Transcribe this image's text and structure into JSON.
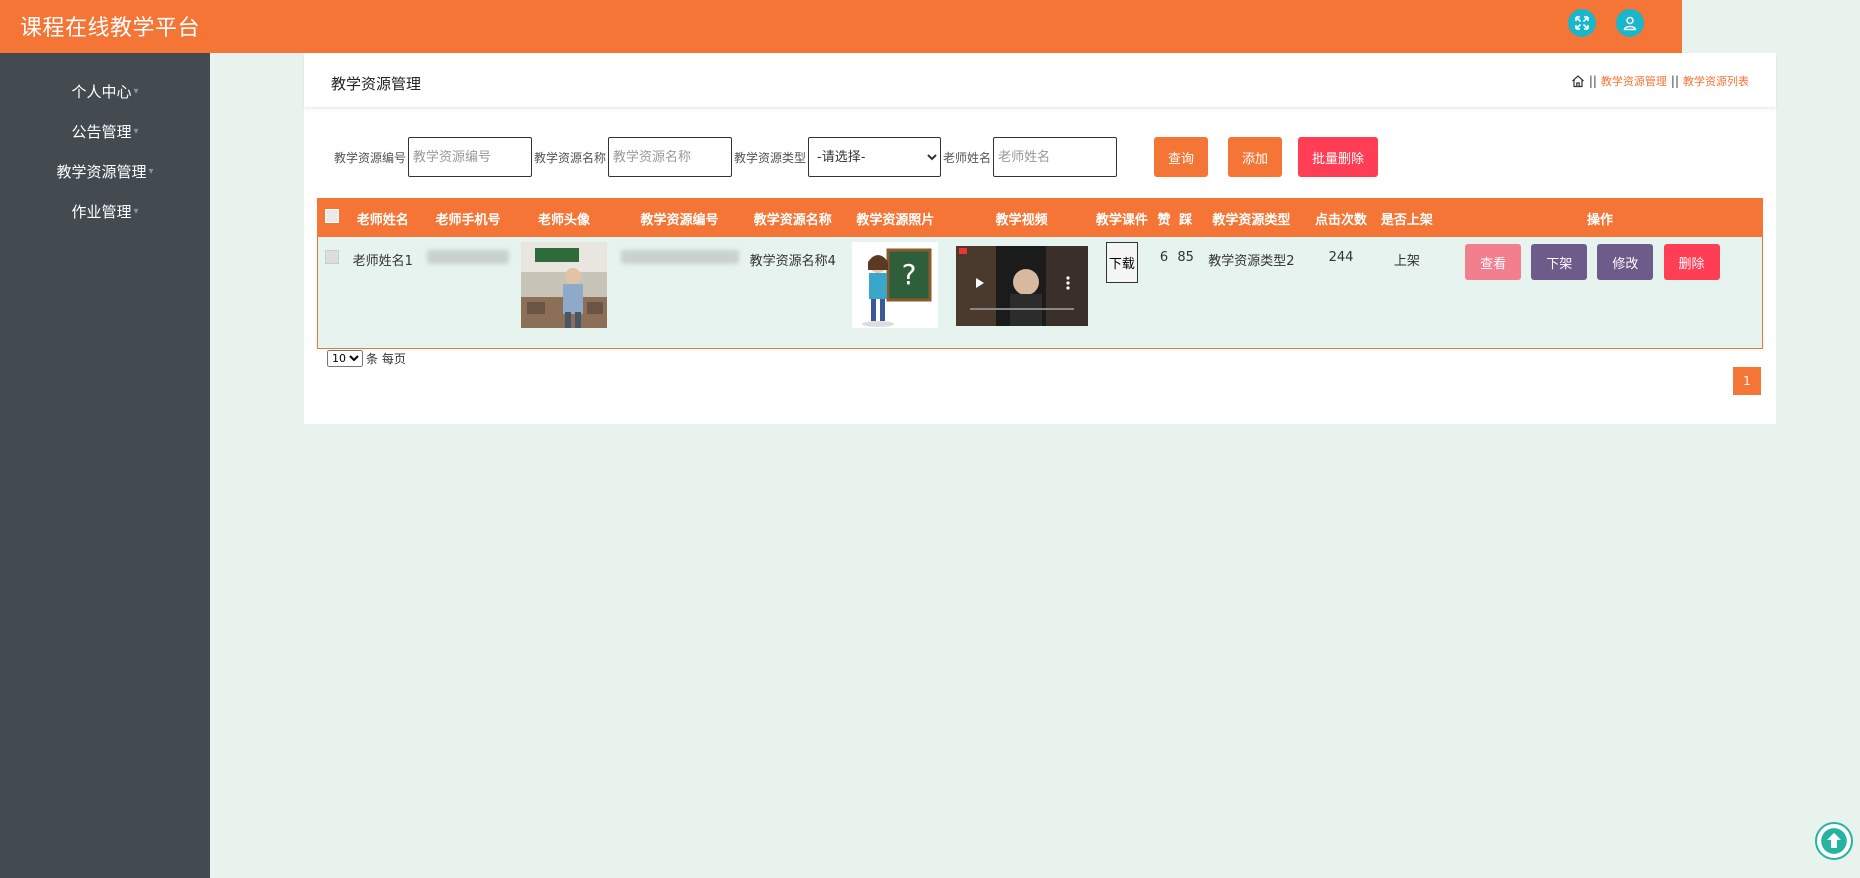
{
  "app": {
    "title": "课程在线教学平台"
  },
  "header": {
    "fullscreen_icon": "expand-icon",
    "user_icon": "user-icon",
    "icon_color": "#19b6cc"
  },
  "colors": {
    "accent": "#f47535",
    "danger": "#ff3d55",
    "sidebar_bg": "#434a50",
    "page_bg": "#e8f3ee"
  },
  "sidebar": {
    "items": [
      {
        "label": "个人中心"
      },
      {
        "label": "公告管理"
      },
      {
        "label": "教学资源管理"
      },
      {
        "label": "作业管理"
      }
    ]
  },
  "panel": {
    "title": "教学资源管理",
    "breadcrumb": {
      "home_icon": "home-icon",
      "sep": "||",
      "items": [
        "教学资源管理",
        "教学资源列表"
      ]
    }
  },
  "search": {
    "code_label": "教学资源编号",
    "code_placeholder": "教学资源编号",
    "name_label": "教学资源名称",
    "name_placeholder": "教学资源名称",
    "type_label": "教学资源类型",
    "type_selected": "-请选择-",
    "teacher_label": "老师姓名",
    "teacher_placeholder": "老师姓名",
    "query_btn": "查询",
    "add_btn": "添加",
    "batch_delete_btn": "批量删除"
  },
  "table": {
    "headers": [
      "老师姓名",
      "老师手机号",
      "老师头像",
      "教学资源编号",
      "教学资源名称",
      "教学资源照片",
      "教学视频",
      "教学课件",
      "赞",
      "踩",
      "教学资源类型",
      "点击次数",
      "是否上架",
      "操作"
    ],
    "rows": [
      {
        "teacher_name": "老师姓名1",
        "name": "教学资源名称4",
        "courseware_btn": "下载",
        "likes": "6",
        "dislikes": "85",
        "type": "教学资源类型2",
        "clicks": "244",
        "status": "上架",
        "actions": {
          "view": "查看",
          "offline": "下架",
          "edit": "修改",
          "delete": "删除"
        }
      }
    ]
  },
  "pager": {
    "page_size": "10",
    "per_page_label": "条 每页",
    "current_page": "1"
  },
  "back_to_top_icon": "arrow-up-icon"
}
